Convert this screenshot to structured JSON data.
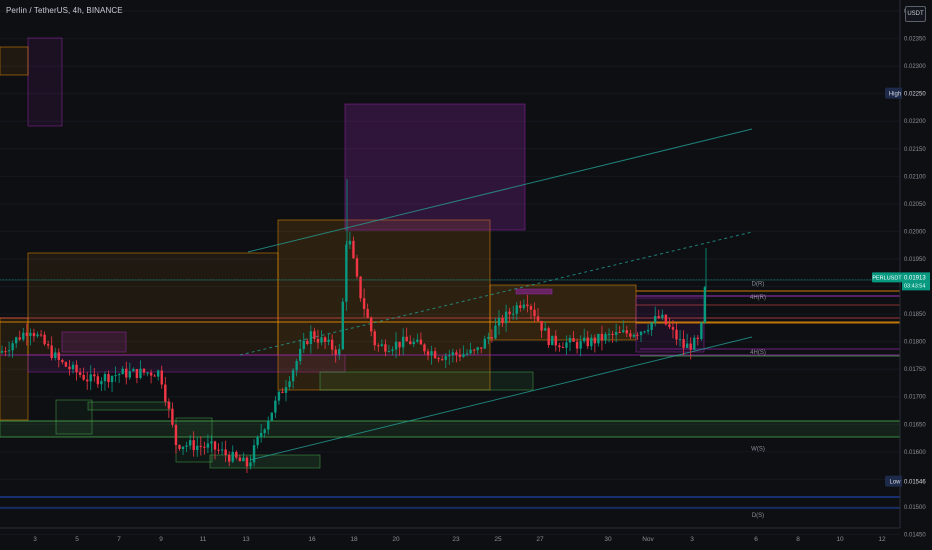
{
  "title": "Perlin / TetherUS, 4h, BINANCE",
  "currency_label": "USDT",
  "chart_data": {
    "type": "candlestick",
    "ylim": [
      0.0144,
      0.0242
    ],
    "yticks": [
      "0.02400",
      "0.02350",
      "0.02300",
      "0.02250",
      "0.02200",
      "0.02150",
      "0.02100",
      "0.02050",
      "0.02000",
      "0.01950",
      "0.01900",
      "0.01850",
      "0.01800",
      "0.01750",
      "0.01700",
      "0.01650",
      "0.01600",
      "0.01550",
      "0.01500",
      "0.01450"
    ],
    "xticks": [
      "3",
      "5",
      "7",
      "9",
      "11",
      "13",
      "16",
      "18",
      "20",
      "23",
      "25",
      "27",
      "30",
      "Nov",
      "3",
      "6",
      "8",
      "10",
      "12"
    ],
    "high": {
      "label": "High",
      "value": "0.02250"
    },
    "low": {
      "label": "Low",
      "value": "0.01546"
    },
    "last": {
      "symbol": "PERLUSDT",
      "price": "0.01913",
      "countdown": "03:43:54"
    },
    "levels": [
      {
        "label": "D(R)",
        "value": 0.01907
      },
      {
        "label": "4H(R)",
        "value": 0.01883
      },
      {
        "label": "4H(S)",
        "value": 0.01783
      },
      {
        "label": "W(S)",
        "value": 0.01608
      },
      {
        "label": "D(S)",
        "value": 0.01487
      }
    ],
    "colors": {
      "up": "#089981",
      "down": "#f23645",
      "supply": "#9c27b0",
      "demand": "#4caf50",
      "orange": "#ff9800",
      "channel": "#26a69a",
      "daily": "#1e3a8a"
    }
  }
}
